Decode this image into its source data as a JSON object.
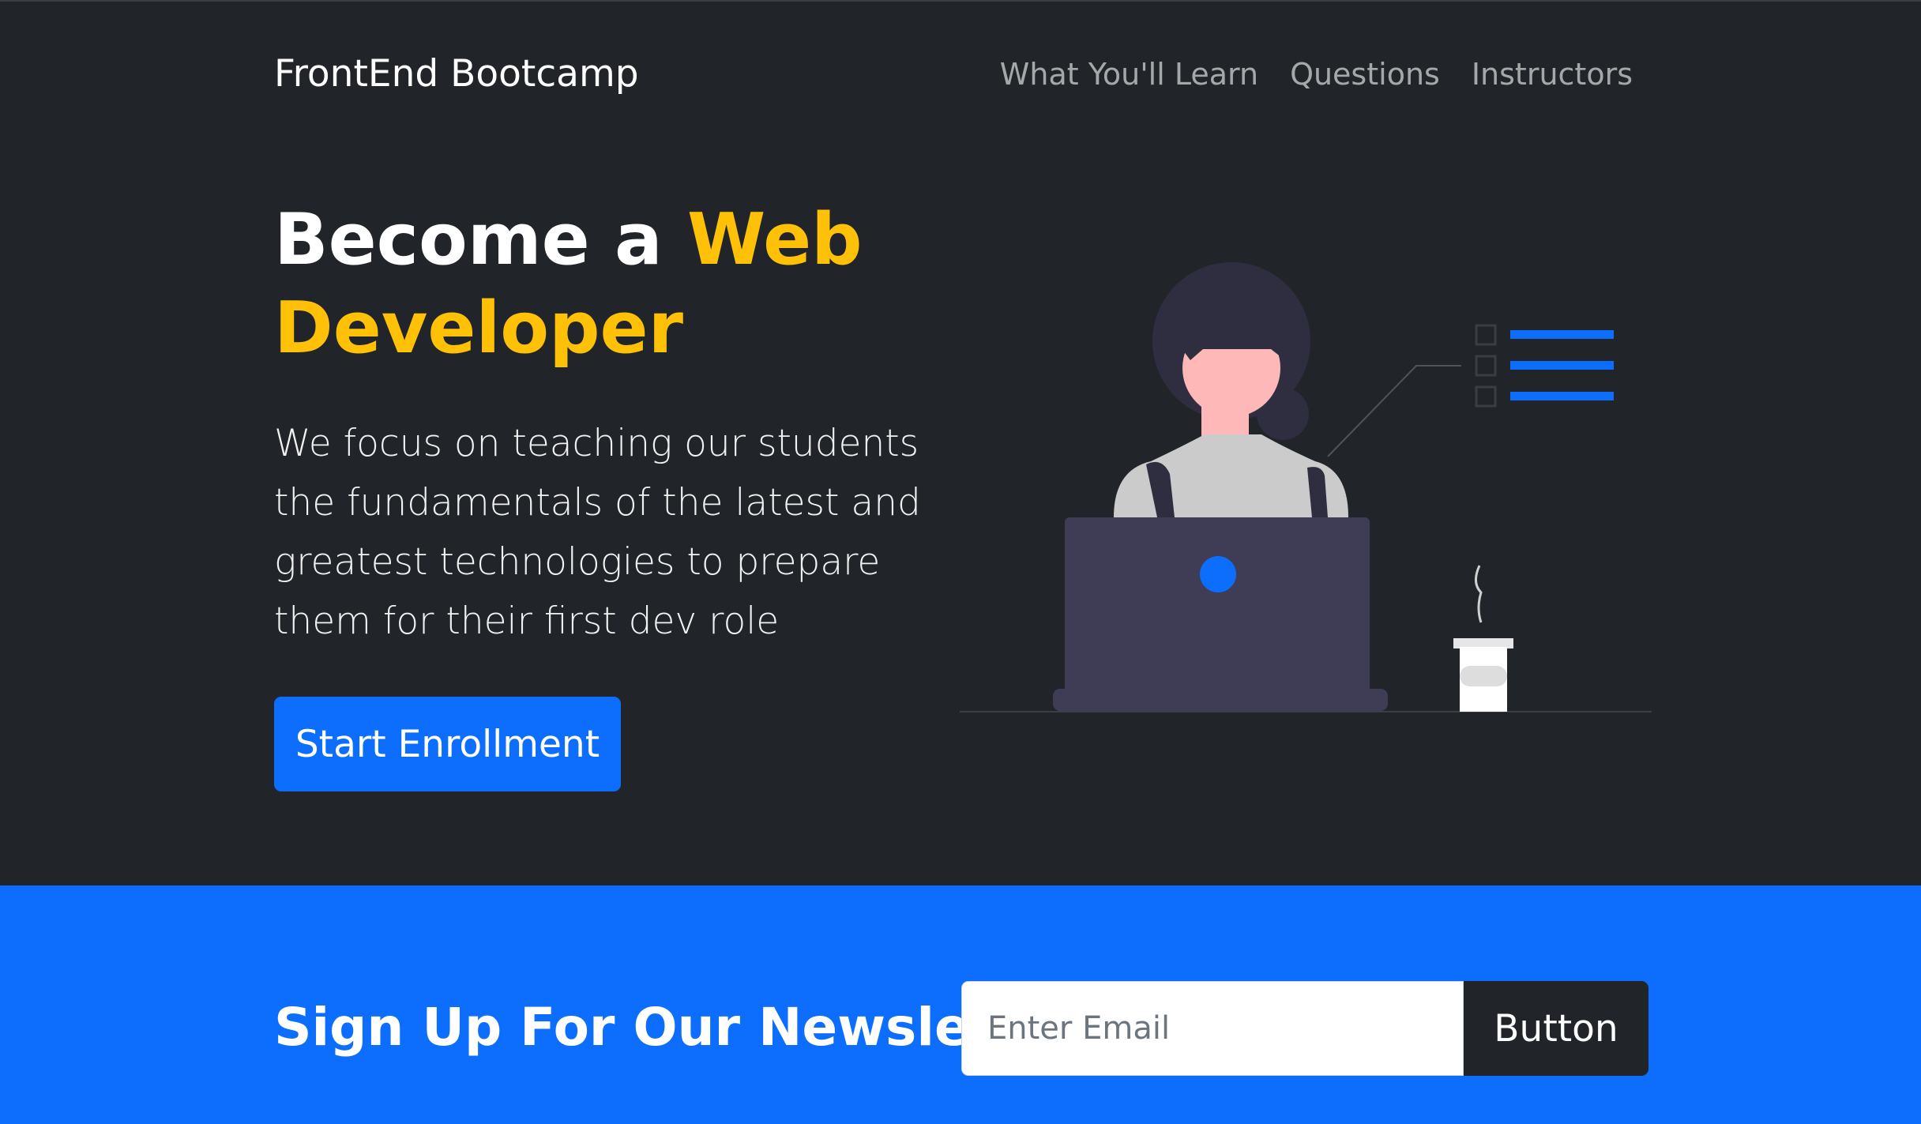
{
  "navbar": {
    "brand": "FrontEnd Bootcamp",
    "links": [
      "What You'll Learn",
      "Questions",
      "Instructors"
    ]
  },
  "hero": {
    "headline_plain": "Become a ",
    "headline_accent": "Web Developer",
    "lead": "We focus on teaching our students the fundamentals of the latest and greatest technologies to prepare them for their first dev role",
    "cta_label": "Start Enrollment",
    "illustration_icon": "woman-at-laptop-illustration"
  },
  "newsletter": {
    "title": "Sign Up For Our Newsletter",
    "email_placeholder": "Enter Email",
    "button_label": "Button"
  },
  "colors": {
    "dark_background": "#212529",
    "accent_yellow": "#ffc107",
    "primary_blue": "#0d6efd",
    "laptop": "#3f3d56",
    "skin": "#ffb8b8"
  }
}
